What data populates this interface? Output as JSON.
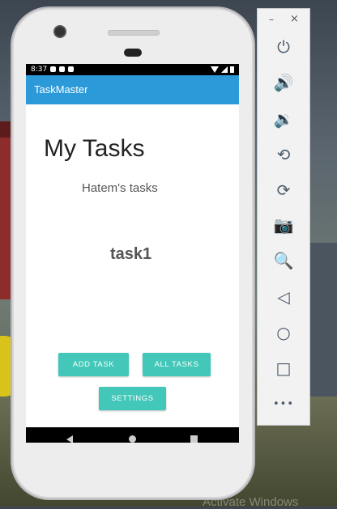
{
  "statusbar": {
    "time": "8:37"
  },
  "app": {
    "title": "TaskMaster"
  },
  "main": {
    "heading": "My Tasks",
    "subheading": "Hatem's tasks",
    "task": "task1"
  },
  "buttons": {
    "add_task": "ADD TASK",
    "all_tasks": "ALL TASKS",
    "settings": "SETTINGS"
  },
  "emulator": {
    "minimize": "–",
    "close": "×",
    "tools": [
      {
        "name": "power-icon",
        "glyph": "⏻"
      },
      {
        "name": "volume-up-icon",
        "glyph": "🔊"
      },
      {
        "name": "volume-down-icon",
        "glyph": "🔉"
      },
      {
        "name": "rotate-left-icon",
        "glyph": "⟲"
      },
      {
        "name": "rotate-right-icon",
        "glyph": "⟳"
      },
      {
        "name": "camera-icon",
        "glyph": "📷"
      },
      {
        "name": "zoom-icon",
        "glyph": "🔍"
      },
      {
        "name": "back-icon",
        "glyph": "◁"
      },
      {
        "name": "home-icon",
        "glyph": "○"
      },
      {
        "name": "overview-icon",
        "glyph": "□"
      },
      {
        "name": "more-icon",
        "glyph": "•••"
      }
    ]
  },
  "desktop": {
    "watermark": "Activate Windows"
  },
  "colors": {
    "appbar": "#2c9ad8",
    "button": "#42c7b8"
  }
}
